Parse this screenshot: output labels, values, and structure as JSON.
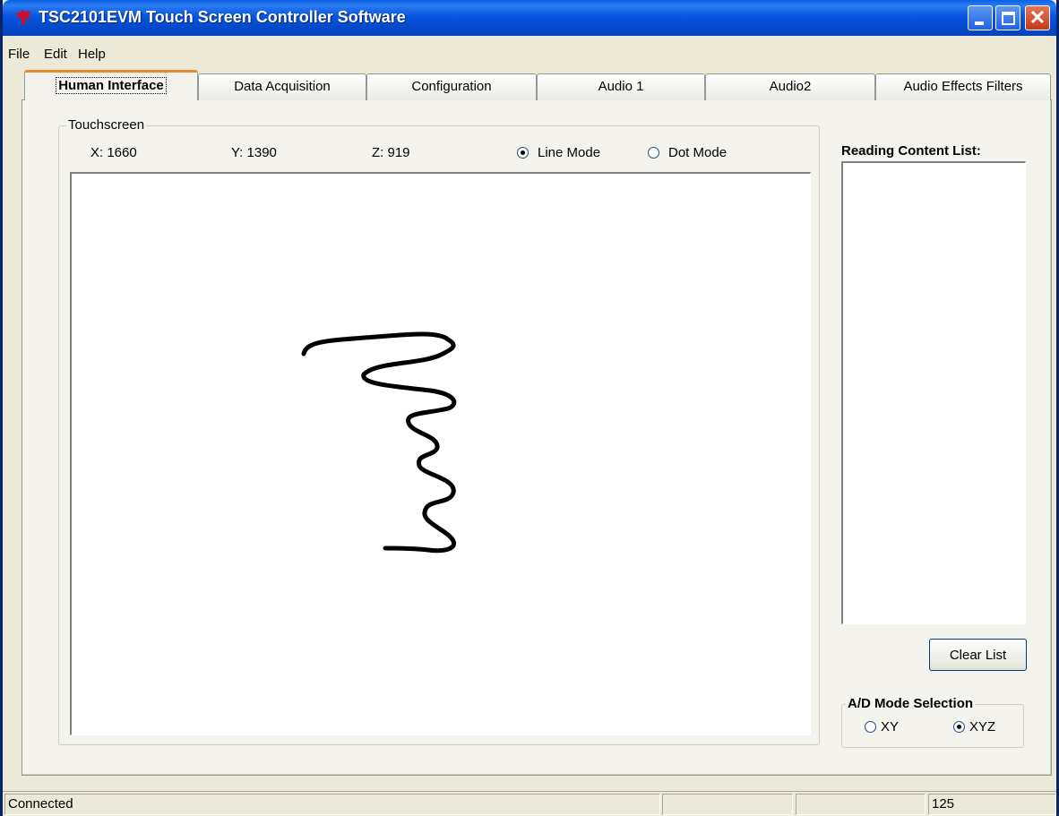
{
  "window": {
    "title": "TSC2101EVM Touch Screen Controller Software",
    "icons": [
      "ti-logo-icon",
      "minimize-icon",
      "maximize-icon",
      "close-icon"
    ]
  },
  "menu": {
    "file": "File",
    "edit": "Edit",
    "help": "Help"
  },
  "tabs": [
    {
      "label": "Human Interface",
      "active": true
    },
    {
      "label": "Data Acquisition"
    },
    {
      "label": "Configuration"
    },
    {
      "label": "Audio 1"
    },
    {
      "label": "Audio2"
    },
    {
      "label": "Audio Effects Filters"
    }
  ],
  "touchscreen": {
    "group_label": "Touchscreen",
    "x": "X: 1660",
    "y": "Y: 1390",
    "z": "Z: 919",
    "line_mode": "Line Mode",
    "dot_mode": "Dot Mode",
    "selected_mode": "Line Mode"
  },
  "reading": {
    "label": "Reading Content List:",
    "clear_button": "Clear List"
  },
  "ad_mode": {
    "label": "A/D Mode Selection",
    "xy": "XY",
    "xyz": "XYZ",
    "selected": "XYZ"
  },
  "status": {
    "connection": "Connected",
    "pane2": "",
    "pane3": "",
    "count": "125"
  },
  "colors": {
    "titlebar": "#0755e0",
    "window_bg": "#ece9d8",
    "active_tab_accent": "#e68b2c",
    "close_button": "#c4391b"
  }
}
